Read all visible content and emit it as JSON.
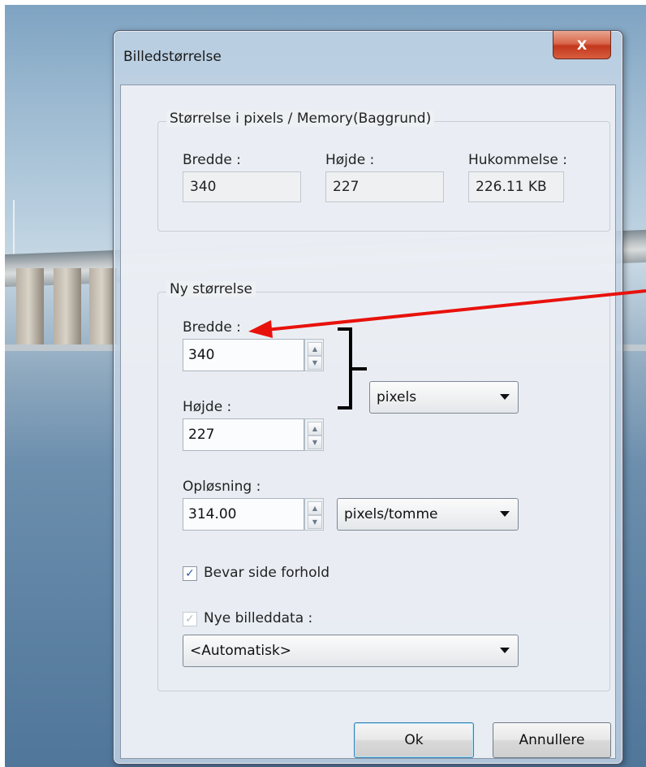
{
  "dialog": {
    "title": "Billedstørrelse",
    "close_label": "X"
  },
  "current_size": {
    "group_label": "Størrelse i pixels / Memory(Baggrund)",
    "width_label": "Bredde :",
    "width_value": "340",
    "height_label": "Højde :",
    "height_value": "227",
    "memory_label": "Hukommelse :",
    "memory_value": "226.11 KB"
  },
  "new_size": {
    "group_label": "Ny størrelse",
    "width_label": "Bredde :",
    "width_value": "340",
    "height_label": "Højde :",
    "height_value": "227",
    "unit_selected": "pixels",
    "resolution_label": "Opløsning :",
    "resolution_value": "314.00",
    "resolution_unit_selected": "pixels/tomme",
    "keep_aspect_label": "Bevar side forhold",
    "keep_aspect_checked": true,
    "resample_label": "Nye billeddata :",
    "resample_checked": true,
    "resample_enabled": false,
    "resample_method_selected": "<Automatisk>"
  },
  "buttons": {
    "ok_label": "Ok",
    "cancel_label": "Annullere"
  },
  "annotation": {
    "arrow_color": "#e8120c",
    "bracket_color": "#000000"
  }
}
